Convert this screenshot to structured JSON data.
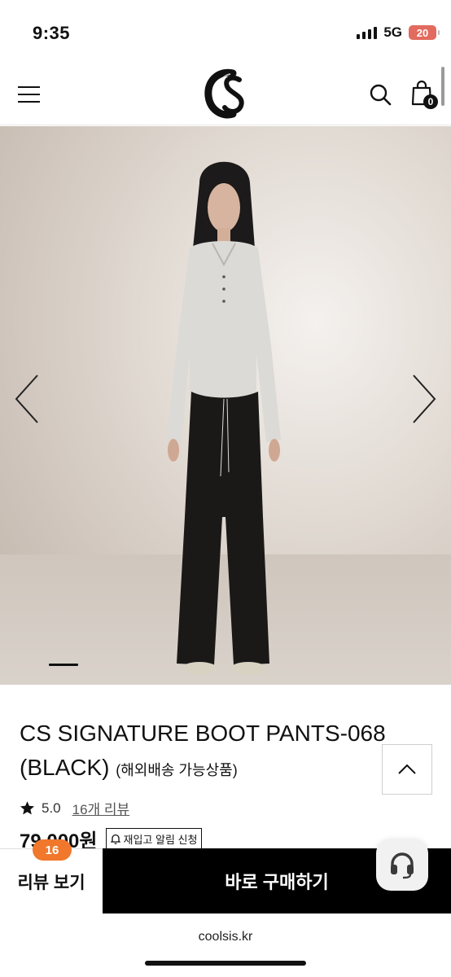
{
  "status": {
    "time": "9:35",
    "network": "5G",
    "battery": "20"
  },
  "header": {
    "cart_count": "0"
  },
  "product": {
    "title": "CS SIGNATURE BOOT PANTS-068",
    "title_suffix": "(BLACK)",
    "title_note": "(해외배송 가능상품)",
    "rating": "5.0",
    "review_link": "16개 리뷰",
    "price": "79,000원",
    "restock_label": "재입고 알림 신청"
  },
  "actions": {
    "review_label": "리뷰 보기",
    "review_count": "16",
    "buy_label": "바로 구매하기"
  },
  "browser": {
    "url": "coolsis.kr"
  },
  "colors": {
    "accent": "#f0772b",
    "primary": "#000000"
  }
}
